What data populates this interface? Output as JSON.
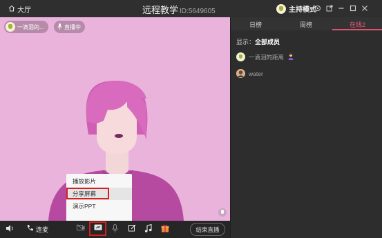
{
  "titlebar": {
    "home_label": "大厅",
    "title": "远程教学",
    "room_id": "ID:5649605",
    "host_mode_label": "主持模式",
    "icons": [
      "gear-icon",
      "share-out-icon",
      "minimize-icon",
      "maximize-icon",
      "close-icon"
    ]
  },
  "video": {
    "host_chip": "一滴泪的...",
    "live_chip": "直播中"
  },
  "share_menu": {
    "items": [
      "播放影片",
      "分享屏幕",
      "演示PPT"
    ],
    "selected": "分享屏幕"
  },
  "bottombar": {
    "connect_mic_label": "连麦",
    "end_live_label": "结束直播",
    "icons": [
      "speaker-icon",
      "phone-icon",
      "camera-icon",
      "screen-share-icon",
      "microphone-icon",
      "edit-icon",
      "music-icon",
      "gift-icon"
    ]
  },
  "panel": {
    "tabs": [
      "日榜",
      "周榜",
      "在线2"
    ],
    "active_tab": "在线2",
    "show_label": "显示：",
    "show_value": "全部成员",
    "members": [
      {
        "name": "一滴泪的距离",
        "role": "host"
      },
      {
        "name": "water",
        "role": "member"
      }
    ]
  },
  "colors": {
    "video_bg": "#eab3dc",
    "accent": "#e0536f",
    "highlight_box": "#d42020"
  }
}
